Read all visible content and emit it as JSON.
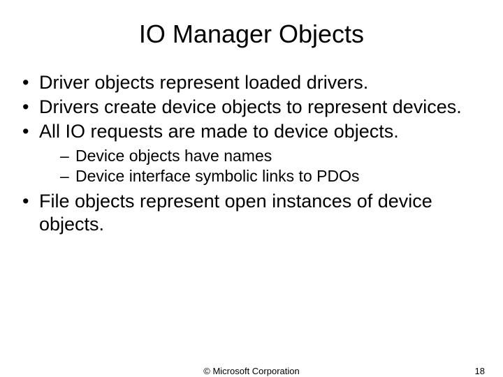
{
  "title": "IO Manager Objects",
  "bullets": {
    "b1": "Driver objects represent loaded drivers.",
    "b2": "Drivers create device objects to represent devices.",
    "b3": "All IO requests are made to device objects.",
    "b3_sub1": "Device objects have names",
    "b3_sub2": "Device interface symbolic links to PDOs",
    "b4": "File objects represent open instances of device objects."
  },
  "footer": {
    "copyright": "© Microsoft Corporation",
    "page": "18"
  }
}
